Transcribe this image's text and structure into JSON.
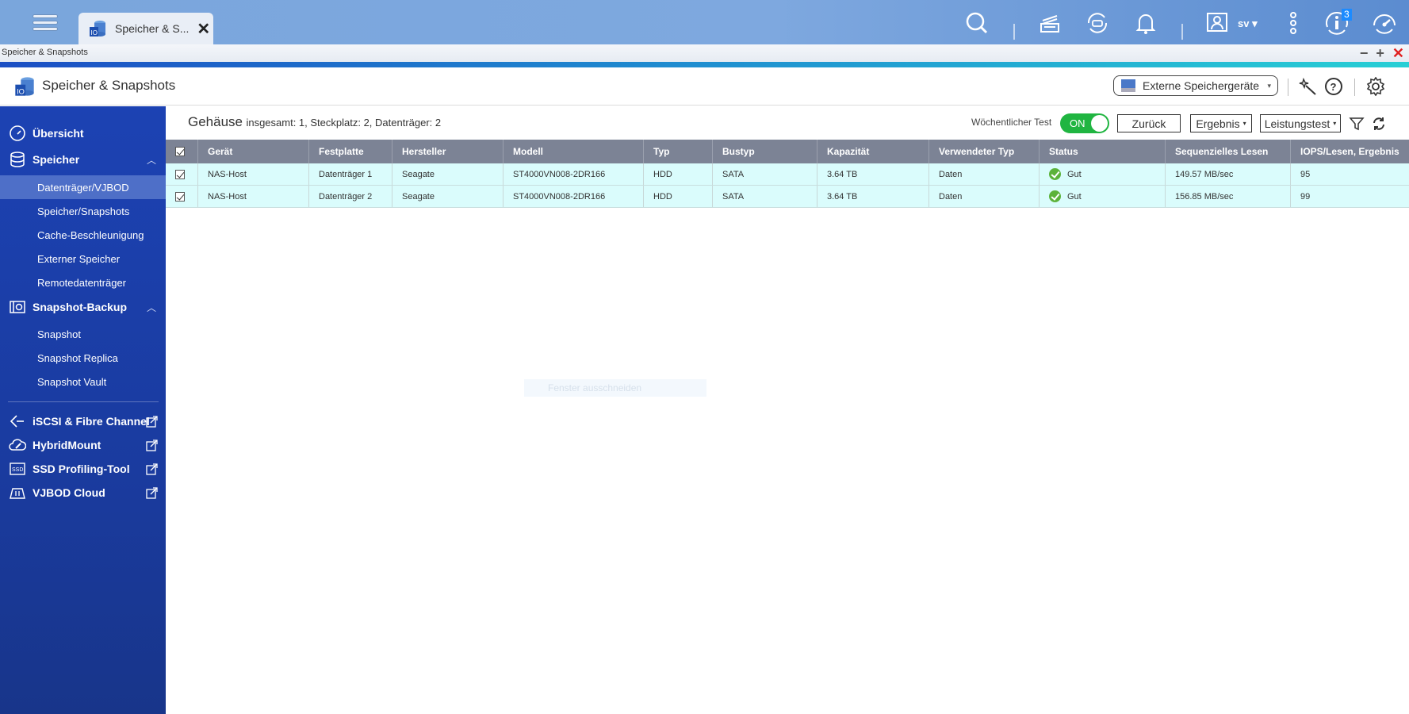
{
  "topbar": {
    "tab_label": "Speicher & S...",
    "tab_close": "✕",
    "user": "sv ▾",
    "notification_count": "3",
    "icons": [
      "menu-icon",
      "search-icon",
      "tasks-icon",
      "sync-icon",
      "bell-icon",
      "user-icon",
      "more-icon",
      "info-icon",
      "dashboard-icon"
    ]
  },
  "window": {
    "title": "Speicher & Snapshots",
    "minimize": "−",
    "maximize": "+",
    "close": "✕"
  },
  "app": {
    "title": "Speicher & Snapshots",
    "external_devices_label": "Externe Speichergeräte",
    "caret": "▾"
  },
  "sidebar": {
    "groups": [
      {
        "label": "Übersicht",
        "icon": "gauge-icon"
      },
      {
        "label": "Speicher",
        "icon": "database-icon",
        "expanded": true,
        "items": [
          "Datenträger/VJBOD",
          "Speicher/Snapshots",
          "Cache-Beschleunigung",
          "Externer Speicher",
          "Remotedatenträger"
        ],
        "active": "Datenträger/VJBOD"
      },
      {
        "label": "Snapshot-Backup",
        "icon": "snapshot-icon",
        "expanded": true,
        "items": [
          "Snapshot",
          "Snapshot Replica",
          "Snapshot Vault"
        ]
      }
    ],
    "links": [
      {
        "label": "iSCSI & Fibre Channel",
        "icon": "iscsi-icon"
      },
      {
        "label": "HybridMount",
        "icon": "cloud-icon"
      },
      {
        "label": "SSD Profiling-Tool",
        "icon": "ssd-icon"
      },
      {
        "label": "VJBOD Cloud",
        "icon": "vjbod-cloud-icon"
      }
    ],
    "chevron": "︿"
  },
  "main": {
    "summary_title": "Gehäuse",
    "summary_detail": "insgesamt: 1, Steckplatz: 2, Datenträger: 2",
    "weekly_test_label": "Wöchentlicher Test",
    "toggle_state": "ON",
    "back_button": "Zurück",
    "result_dropdown": "Ergebnis",
    "benchmark_dropdown": "Leistungstest",
    "caret": "▾",
    "ghost_text": "Fenster ausschneiden"
  },
  "table": {
    "columns": [
      "Gerät",
      "Festplatte",
      "Hersteller",
      "Modell",
      "Typ",
      "Bustyp",
      "Kapazität",
      "Verwendeter Typ",
      "Status",
      "Sequenzielles Lesen",
      "IOPS/Lesen, Ergebnis"
    ],
    "rows": [
      {
        "checked": true,
        "device": "NAS-Host",
        "disk": "Datenträger 1",
        "vendor": "Seagate",
        "model": "ST4000VN008-2DR166",
        "type": "HDD",
        "bus": "SATA",
        "capacity": "3.64 TB",
        "used_type": "Daten",
        "status": "Gut",
        "seq_read": "149.57 MB/sec",
        "iops": "95"
      },
      {
        "checked": true,
        "device": "NAS-Host",
        "disk": "Datenträger 2",
        "vendor": "Seagate",
        "model": "ST4000VN008-2DR166",
        "type": "HDD",
        "bus": "SATA",
        "capacity": "3.64 TB",
        "used_type": "Daten",
        "status": "Gut",
        "seq_read": "156.85 MB/sec",
        "iops": "99"
      }
    ]
  },
  "colors": {
    "sidebar": "#1b3a9c",
    "header_row": "#7c8395",
    "data_row": "#dafcfc",
    "toggle_on": "#20b541",
    "status_ok": "#5cb23a"
  }
}
